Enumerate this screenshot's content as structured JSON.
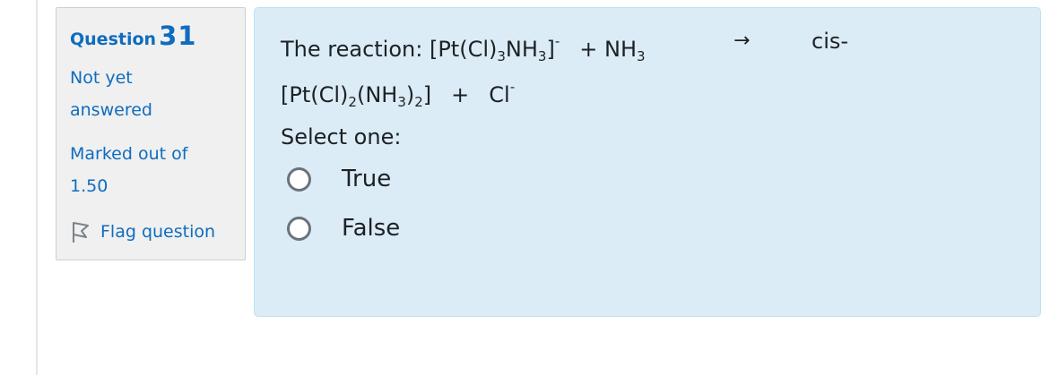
{
  "question": {
    "label": "Question",
    "number": "31",
    "status_line1": "Not yet",
    "status_line2": "answered",
    "marks_line1": "Marked out of",
    "marks_line2": "1.50",
    "flag_label": "Flag question"
  },
  "content": {
    "prefix": "The reaction: [Pt(Cl)",
    "sub1": "3",
    "part2": "NH",
    "sub2": "3",
    "part3": "]",
    "sup1": "-",
    "plus1": "+ NH",
    "sub3": "3",
    "arrow": "→",
    "cis": "cis-",
    "line2a": "[Pt(Cl)",
    "sub4": "2",
    "line2b": "(NH",
    "sub5": "3",
    "line2c": ")",
    "sub6": "2",
    "line2d": "]",
    "plus2": "+",
    "cl": "Cl",
    "sup2": "-",
    "select_label": "Select one:",
    "options": [
      "True",
      "False"
    ]
  },
  "colors": {
    "accent": "#0f6cbf",
    "panel_bg": "#dbecf6",
    "info_bg": "#f0f0f0"
  },
  "icons": {
    "flag": "flag-outline-icon"
  }
}
